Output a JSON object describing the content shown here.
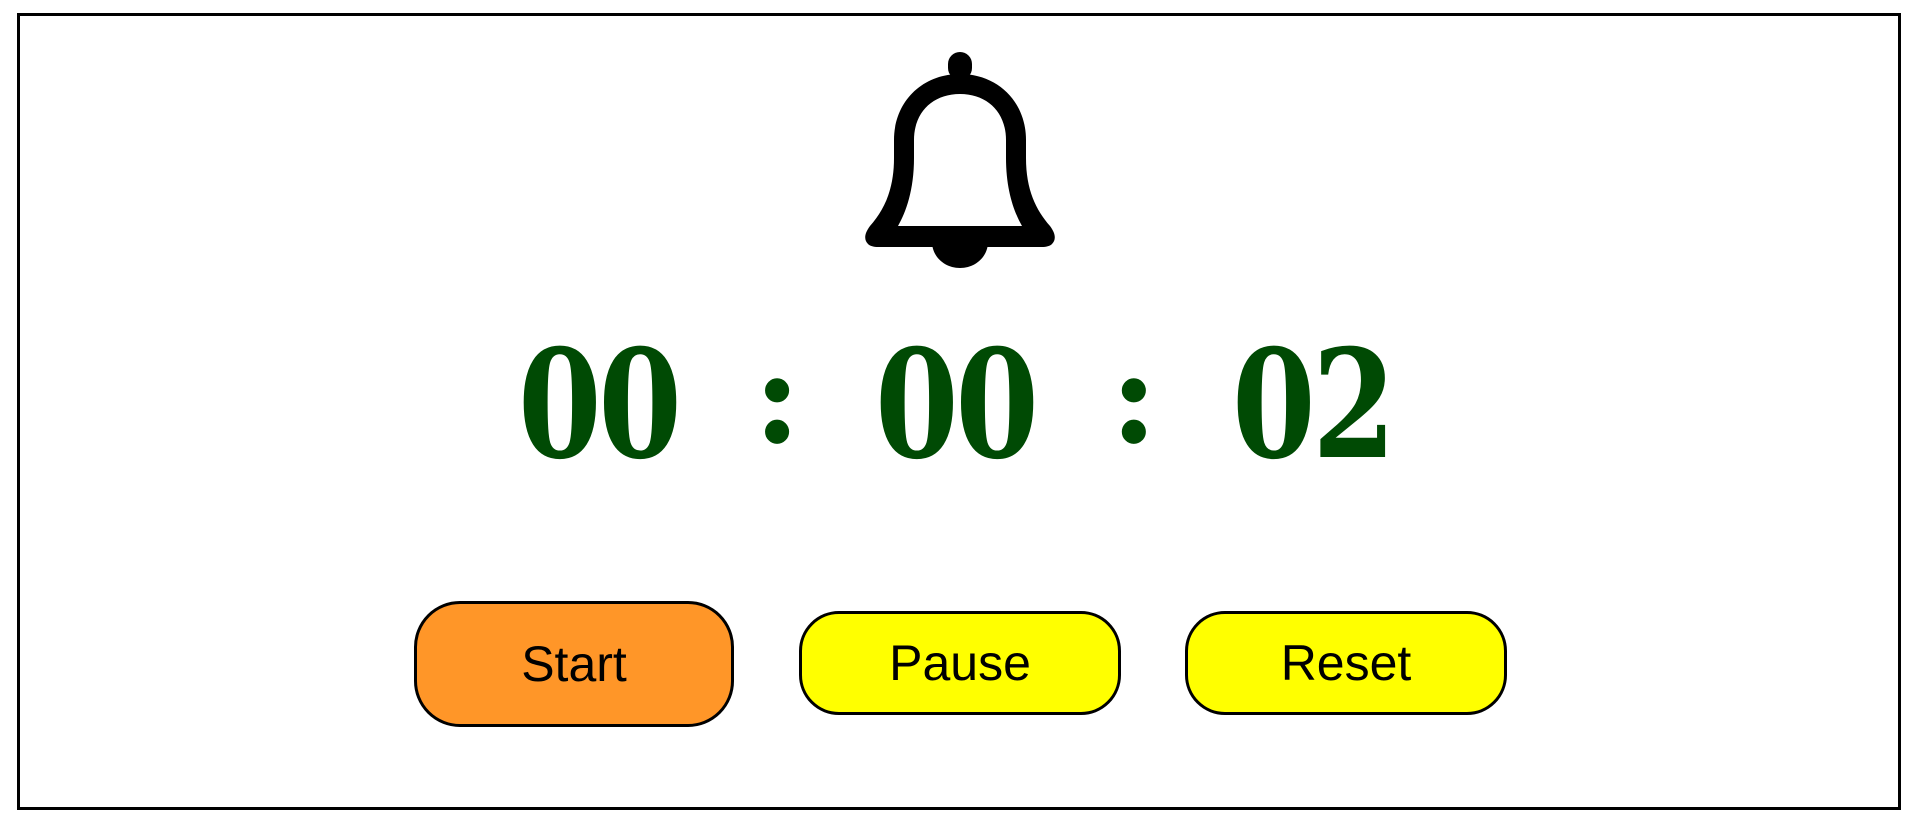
{
  "timer": {
    "hours": "00",
    "minutes": "00",
    "seconds": "02",
    "separator": ":"
  },
  "buttons": {
    "start_label": "Start",
    "pause_label": "Pause",
    "reset_label": "Reset"
  },
  "icons": {
    "alarm": "bell-icon"
  },
  "colors": {
    "timer_text": "#004a04",
    "start_button": "#ff9628",
    "pause_button": "#ffff00",
    "reset_button": "#ffff00",
    "border": "#000000"
  }
}
